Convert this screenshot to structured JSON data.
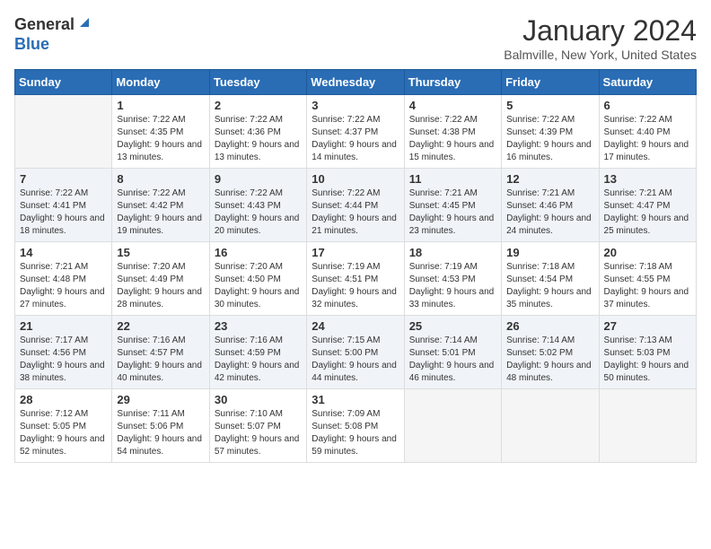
{
  "header": {
    "logo_general": "General",
    "logo_blue": "Blue",
    "month_title": "January 2024",
    "location": "Balmville, New York, United States"
  },
  "weekdays": [
    "Sunday",
    "Monday",
    "Tuesday",
    "Wednesday",
    "Thursday",
    "Friday",
    "Saturday"
  ],
  "weeks": [
    [
      {
        "day": "",
        "sunrise": "",
        "sunset": "",
        "daylight": ""
      },
      {
        "day": "1",
        "sunrise": "Sunrise: 7:22 AM",
        "sunset": "Sunset: 4:35 PM",
        "daylight": "Daylight: 9 hours and 13 minutes."
      },
      {
        "day": "2",
        "sunrise": "Sunrise: 7:22 AM",
        "sunset": "Sunset: 4:36 PM",
        "daylight": "Daylight: 9 hours and 13 minutes."
      },
      {
        "day": "3",
        "sunrise": "Sunrise: 7:22 AM",
        "sunset": "Sunset: 4:37 PM",
        "daylight": "Daylight: 9 hours and 14 minutes."
      },
      {
        "day": "4",
        "sunrise": "Sunrise: 7:22 AM",
        "sunset": "Sunset: 4:38 PM",
        "daylight": "Daylight: 9 hours and 15 minutes."
      },
      {
        "day": "5",
        "sunrise": "Sunrise: 7:22 AM",
        "sunset": "Sunset: 4:39 PM",
        "daylight": "Daylight: 9 hours and 16 minutes."
      },
      {
        "day": "6",
        "sunrise": "Sunrise: 7:22 AM",
        "sunset": "Sunset: 4:40 PM",
        "daylight": "Daylight: 9 hours and 17 minutes."
      }
    ],
    [
      {
        "day": "7",
        "sunrise": "Sunrise: 7:22 AM",
        "sunset": "Sunset: 4:41 PM",
        "daylight": "Daylight: 9 hours and 18 minutes."
      },
      {
        "day": "8",
        "sunrise": "Sunrise: 7:22 AM",
        "sunset": "Sunset: 4:42 PM",
        "daylight": "Daylight: 9 hours and 19 minutes."
      },
      {
        "day": "9",
        "sunrise": "Sunrise: 7:22 AM",
        "sunset": "Sunset: 4:43 PM",
        "daylight": "Daylight: 9 hours and 20 minutes."
      },
      {
        "day": "10",
        "sunrise": "Sunrise: 7:22 AM",
        "sunset": "Sunset: 4:44 PM",
        "daylight": "Daylight: 9 hours and 21 minutes."
      },
      {
        "day": "11",
        "sunrise": "Sunrise: 7:21 AM",
        "sunset": "Sunset: 4:45 PM",
        "daylight": "Daylight: 9 hours and 23 minutes."
      },
      {
        "day": "12",
        "sunrise": "Sunrise: 7:21 AM",
        "sunset": "Sunset: 4:46 PM",
        "daylight": "Daylight: 9 hours and 24 minutes."
      },
      {
        "day": "13",
        "sunrise": "Sunrise: 7:21 AM",
        "sunset": "Sunset: 4:47 PM",
        "daylight": "Daylight: 9 hours and 25 minutes."
      }
    ],
    [
      {
        "day": "14",
        "sunrise": "Sunrise: 7:21 AM",
        "sunset": "Sunset: 4:48 PM",
        "daylight": "Daylight: 9 hours and 27 minutes."
      },
      {
        "day": "15",
        "sunrise": "Sunrise: 7:20 AM",
        "sunset": "Sunset: 4:49 PM",
        "daylight": "Daylight: 9 hours and 28 minutes."
      },
      {
        "day": "16",
        "sunrise": "Sunrise: 7:20 AM",
        "sunset": "Sunset: 4:50 PM",
        "daylight": "Daylight: 9 hours and 30 minutes."
      },
      {
        "day": "17",
        "sunrise": "Sunrise: 7:19 AM",
        "sunset": "Sunset: 4:51 PM",
        "daylight": "Daylight: 9 hours and 32 minutes."
      },
      {
        "day": "18",
        "sunrise": "Sunrise: 7:19 AM",
        "sunset": "Sunset: 4:53 PM",
        "daylight": "Daylight: 9 hours and 33 minutes."
      },
      {
        "day": "19",
        "sunrise": "Sunrise: 7:18 AM",
        "sunset": "Sunset: 4:54 PM",
        "daylight": "Daylight: 9 hours and 35 minutes."
      },
      {
        "day": "20",
        "sunrise": "Sunrise: 7:18 AM",
        "sunset": "Sunset: 4:55 PM",
        "daylight": "Daylight: 9 hours and 37 minutes."
      }
    ],
    [
      {
        "day": "21",
        "sunrise": "Sunrise: 7:17 AM",
        "sunset": "Sunset: 4:56 PM",
        "daylight": "Daylight: 9 hours and 38 minutes."
      },
      {
        "day": "22",
        "sunrise": "Sunrise: 7:16 AM",
        "sunset": "Sunset: 4:57 PM",
        "daylight": "Daylight: 9 hours and 40 minutes."
      },
      {
        "day": "23",
        "sunrise": "Sunrise: 7:16 AM",
        "sunset": "Sunset: 4:59 PM",
        "daylight": "Daylight: 9 hours and 42 minutes."
      },
      {
        "day": "24",
        "sunrise": "Sunrise: 7:15 AM",
        "sunset": "Sunset: 5:00 PM",
        "daylight": "Daylight: 9 hours and 44 minutes."
      },
      {
        "day": "25",
        "sunrise": "Sunrise: 7:14 AM",
        "sunset": "Sunset: 5:01 PM",
        "daylight": "Daylight: 9 hours and 46 minutes."
      },
      {
        "day": "26",
        "sunrise": "Sunrise: 7:14 AM",
        "sunset": "Sunset: 5:02 PM",
        "daylight": "Daylight: 9 hours and 48 minutes."
      },
      {
        "day": "27",
        "sunrise": "Sunrise: 7:13 AM",
        "sunset": "Sunset: 5:03 PM",
        "daylight": "Daylight: 9 hours and 50 minutes."
      }
    ],
    [
      {
        "day": "28",
        "sunrise": "Sunrise: 7:12 AM",
        "sunset": "Sunset: 5:05 PM",
        "daylight": "Daylight: 9 hours and 52 minutes."
      },
      {
        "day": "29",
        "sunrise": "Sunrise: 7:11 AM",
        "sunset": "Sunset: 5:06 PM",
        "daylight": "Daylight: 9 hours and 54 minutes."
      },
      {
        "day": "30",
        "sunrise": "Sunrise: 7:10 AM",
        "sunset": "Sunset: 5:07 PM",
        "daylight": "Daylight: 9 hours and 57 minutes."
      },
      {
        "day": "31",
        "sunrise": "Sunrise: 7:09 AM",
        "sunset": "Sunset: 5:08 PM",
        "daylight": "Daylight: 9 hours and 59 minutes."
      },
      {
        "day": "",
        "sunrise": "",
        "sunset": "",
        "daylight": ""
      },
      {
        "day": "",
        "sunrise": "",
        "sunset": "",
        "daylight": ""
      },
      {
        "day": "",
        "sunrise": "",
        "sunset": "",
        "daylight": ""
      }
    ]
  ]
}
